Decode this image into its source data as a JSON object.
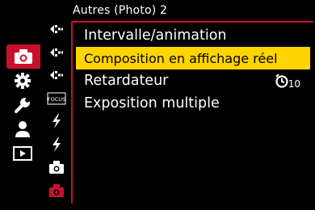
{
  "window": {
    "title": "Autres (Photo) 2"
  },
  "main_tabs": [
    {
      "icon": "camera-icon",
      "active": true
    },
    {
      "icon": "gear-icon",
      "active": false
    },
    {
      "icon": "wrench-icon",
      "active": false
    },
    {
      "icon": "person-icon",
      "active": false
    },
    {
      "icon": "playback-icon",
      "active": false
    }
  ],
  "sub_tabs": [
    {
      "icon": "arrows-icon"
    },
    {
      "icon": "arrows-icon"
    },
    {
      "icon": "arrows-icon"
    },
    {
      "icon": "focus-icon",
      "label": "FOCUS"
    },
    {
      "icon": "flash-icon"
    },
    {
      "icon": "flash-icon"
    },
    {
      "icon": "camera-small-icon"
    },
    {
      "icon": "camera-small-red-icon",
      "active": true
    }
  ],
  "menu": {
    "items": [
      {
        "label": "Intervalle/animation",
        "selected": false
      },
      {
        "label": "Composition en affichage réel",
        "selected": true
      },
      {
        "label": "Retardateur",
        "selected": false,
        "value": "10",
        "value_icon": "self-timer-icon"
      },
      {
        "label": "Exposition multiple",
        "selected": false
      }
    ]
  },
  "colors": {
    "accent": "#c8102e",
    "highlight": "#ffd400",
    "background": "#000000",
    "text": "#ffffff"
  }
}
